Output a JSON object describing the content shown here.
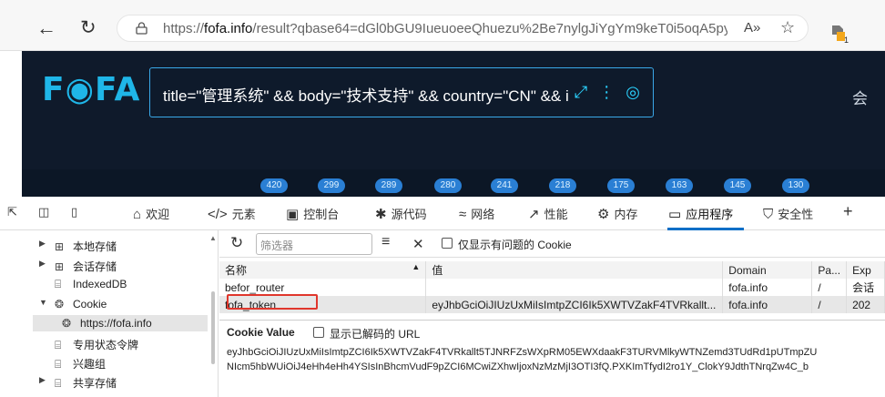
{
  "browser": {
    "url_prefix": "https://",
    "url_host": "fofa.info",
    "url_rest": "/result?qbase64=dGl0bGU9IueuoeeQhuezu%2Be7nylgJiYgYm9keT0i5oqA5py...",
    "read_aloud": "A»",
    "extension_badge": "1"
  },
  "fofa": {
    "logo": "F◉FA",
    "query": "title=\"管理系统\" && body=\"技术支持\" && country=\"CN\" && i",
    "right_text": "会",
    "counts": [
      "420",
      "299",
      "289",
      "280",
      "241",
      "218",
      "175",
      "163",
      "145",
      "130"
    ]
  },
  "devtools": {
    "tabs": [
      {
        "icon": "⌂",
        "label": "欢迎"
      },
      {
        "icon": "</>",
        "label": "元素"
      },
      {
        "icon": "▣",
        "label": "控制台"
      },
      {
        "icon": "✱",
        "label": "源代码"
      },
      {
        "icon": "≈",
        "label": "网络"
      },
      {
        "icon": "↗",
        "label": "性能"
      },
      {
        "icon": "⚙",
        "label": "内存"
      },
      {
        "icon": "▭",
        "label": "应用程序"
      },
      {
        "icon": "⛉",
        "label": "安全性"
      }
    ],
    "add_tab": "+"
  },
  "sidebar": {
    "items": [
      {
        "label": "本地存储",
        "icon": "⊞",
        "arrow": "▶"
      },
      {
        "label": "会话存储",
        "icon": "⊞",
        "arrow": "▶"
      },
      {
        "label": "IndexedDB",
        "icon": "⌸",
        "arrow": ""
      },
      {
        "label": "Cookie",
        "icon": "❂",
        "arrow": "▼"
      },
      {
        "label": "https://fofa.info",
        "icon": "❂",
        "arrow": ""
      },
      {
        "label": "专用状态令牌",
        "icon": "⌸",
        "arrow": ""
      },
      {
        "label": "兴趣组",
        "icon": "⌸",
        "arrow": ""
      },
      {
        "label": "共享存储",
        "icon": "⌸",
        "arrow": "▶"
      }
    ]
  },
  "toolbar": {
    "refresh_icon": "↻",
    "filter_placeholder": "筛选器",
    "clear_icon": "≡",
    "delete_icon": "✕",
    "only_issues": "仅显示有问题的 Cookie"
  },
  "table": {
    "headers": [
      "名称",
      "值",
      "Domain",
      "Pa...",
      "Exp"
    ],
    "sort_icon": "▲",
    "rows": [
      [
        "befor_router",
        "",
        "fofa.info",
        "/",
        "会话"
      ],
      [
        "fofa_token",
        "eyJhbGciOiJIUzUxMiIsImtpZCI6Ik5XWTVZakF4TVRkallt...",
        "fofa.info",
        "/",
        "202"
      ]
    ]
  },
  "cookie_value": {
    "title": "Cookie Value",
    "show_decoded": "显示已解码的 URL",
    "line1": "eyJhbGciOiJIUzUxMiIsImtpZCI6Ik5XWTVZakF4TVRkallt5TJNRFZsWXpRM05EWXdaakF3TURVMlkyWTNZemd3TUdRd1pUTmpZU",
    "line2": "NIcm5hbWUiOiJ4eHh4eHh4YSIsInBhcmVudF9pZCI6MCwiZXhwIjoxNzMzMjI3OTI3fQ.PXKImTfydI2ro1Y_ClokY9JdthTNrqZw4C_b"
  }
}
